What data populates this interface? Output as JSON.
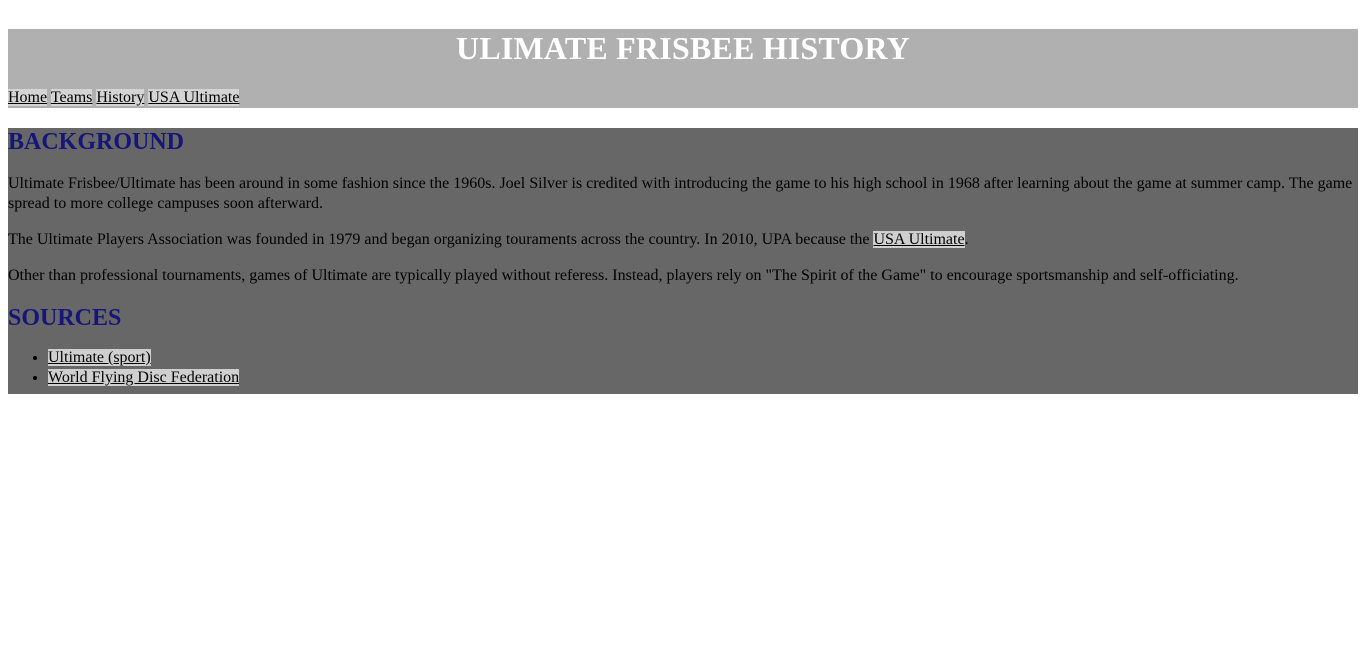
{
  "header": {
    "title": "ULIMATE FRISBEE HISTORY"
  },
  "nav": {
    "items": [
      {
        "label": "Home"
      },
      {
        "label": "Teams"
      },
      {
        "label": "History"
      },
      {
        "label": "USA Ultimate"
      }
    ]
  },
  "background_section": {
    "heading": "BACKGROUND",
    "paragraph1": "Ultimate Frisbee/Ultimate has been around in some fashion since the 1960s. Joel Silver is credited with introducing the game to his high school in 1968 after learning about the game at summer camp. The game spread to more college campuses soon afterward.",
    "paragraph2_text": "The Ultimate Players Association was founded in 1979 and began organizing touraments across the country. In 2010, UPA because the ",
    "paragraph2_link": "USA Ultimate",
    "paragraph2_end": ".",
    "paragraph3": "Other than professional tournaments, games of Ultimate are typically played without referess. Instead, players rely on \"The Spirit of the Game\" to encourage sportsmanship and self-officiating."
  },
  "sources_section": {
    "heading": "SOURCES",
    "links": [
      {
        "label": "Ultimate (sport)"
      },
      {
        "label": "World Flying Disc Federation"
      }
    ]
  }
}
